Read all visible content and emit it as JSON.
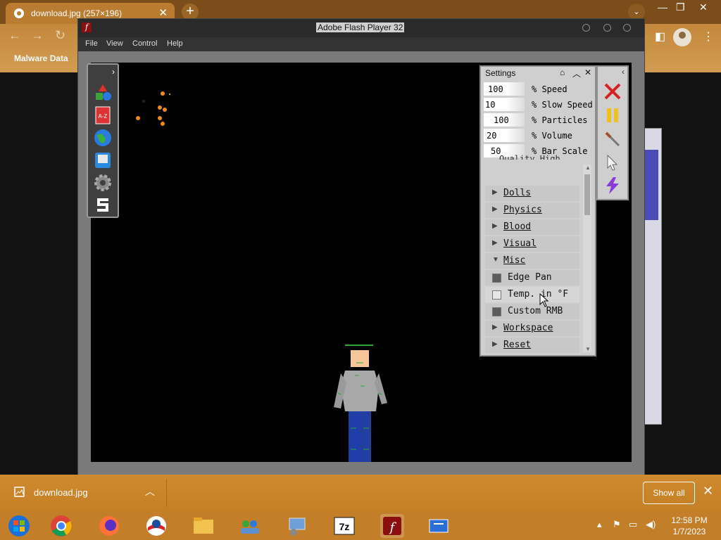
{
  "browser": {
    "tab_title": "download.jpg (257×196)",
    "tab_close": "✕",
    "new_tab": "+",
    "bookmark": "Malware Data",
    "window_controls": [
      "—",
      "❐",
      "✕"
    ]
  },
  "flash": {
    "title": "Adobe Flash Player 32",
    "menu": [
      "File",
      "View",
      "Control",
      "Help"
    ]
  },
  "toolbox": {
    "tools": [
      {
        "icon": "shapes-icon"
      },
      {
        "icon": "a-z-book-icon",
        "label": "A-Z"
      },
      {
        "icon": "globe-icon"
      },
      {
        "icon": "save-icon"
      },
      {
        "icon": "gear-icon"
      },
      {
        "icon": "s-logo-icon"
      }
    ]
  },
  "settings": {
    "title": "Settings",
    "rows": [
      {
        "value": "100",
        "label": "% Speed"
      },
      {
        "value": "10",
        "label": "% Slow Speed"
      },
      {
        "value": "100",
        "label": "% Particles"
      },
      {
        "value": "20",
        "label": "% Volume"
      },
      {
        "value": "50",
        "label": "% Bar Scale"
      }
    ],
    "cut_text": "Quality High",
    "sections": [
      {
        "type": "group",
        "label": "Dolls",
        "expanded": false
      },
      {
        "type": "group",
        "label": "Physics",
        "expanded": false
      },
      {
        "type": "group",
        "label": "Blood",
        "expanded": false
      },
      {
        "type": "group",
        "label": "Visual",
        "expanded": false
      },
      {
        "type": "group",
        "label": "Misc",
        "expanded": true
      },
      {
        "type": "check",
        "label": "Edge Pan",
        "checked": true
      },
      {
        "type": "check",
        "label": "Temp. in °F",
        "checked": false
      },
      {
        "type": "check",
        "label": "Custom RMB",
        "checked": true
      },
      {
        "type": "group",
        "label": "Workspace",
        "expanded": false
      },
      {
        "type": "group",
        "label": "Reset",
        "expanded": false
      }
    ]
  },
  "downloads": {
    "file": "download.jpg",
    "show_all": "Show all"
  },
  "taskbar": {
    "time": "12:58 PM",
    "date": "1/7/2023"
  },
  "colors": {
    "accent": "#c47f25",
    "stage": "#000000",
    "panel": "#cfcfcf"
  }
}
